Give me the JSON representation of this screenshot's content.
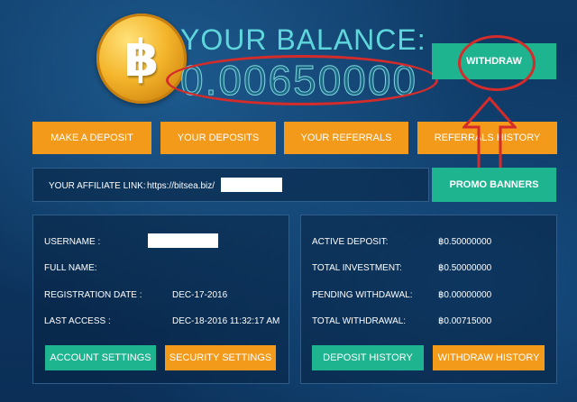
{
  "coin": {
    "icon": "bitcoin-icon",
    "glyph": "฿"
  },
  "balance": {
    "title": "YOUR BALANCE:",
    "value": "0.00650000"
  },
  "buttons": {
    "withdraw": "WITHDRAW",
    "make_deposit": "MAKE A DEPOSIT",
    "your_deposits": "YOUR DEPOSITS",
    "your_referrals": "YOUR REFERRALS",
    "referrals_history": "REFERRALS HISTORY",
    "promo_banners": "PROMO BANNERS",
    "account_settings": "ACCOUNT SETTINGS",
    "security_settings": "SECURITY SETTINGS",
    "deposit_history": "DEPOSIT HISTORY",
    "withdraw_history": "WITHDRAW HISTORY"
  },
  "affiliate": {
    "label": "YOUR AFFILIATE LINK:",
    "url": "https://bitsea.biz/"
  },
  "user": {
    "username_label": "USERNAME :",
    "fullname_label": "FULL NAME:",
    "registration_label": "REGISTRATION DATE :",
    "registration_value": "DEC-17-2016",
    "last_access_label": "LAST ACCESS :",
    "last_access_value": "DEC-18-2016 11:32:17 AM"
  },
  "stats": {
    "active_deposit_label": "ACTIVE DEPOSIT:",
    "active_deposit_value": "฿0.50000000",
    "total_investment_label": "TOTAL INVESTMENT:",
    "total_investment_value": "฿0.50000000",
    "pending_withdrawal_label": "PENDING WITHDAWAL:",
    "pending_withdrawal_value": "฿0.00000000",
    "total_withdrawal_label": "TOTAL WITHDRAWAL:",
    "total_withdrawal_value": "฿0.00715000"
  },
  "colors": {
    "teal": "#1fb490",
    "orange": "#f39a1a",
    "annotation_red": "#d42b2b",
    "balance_cyan": "#5fd6dc"
  }
}
